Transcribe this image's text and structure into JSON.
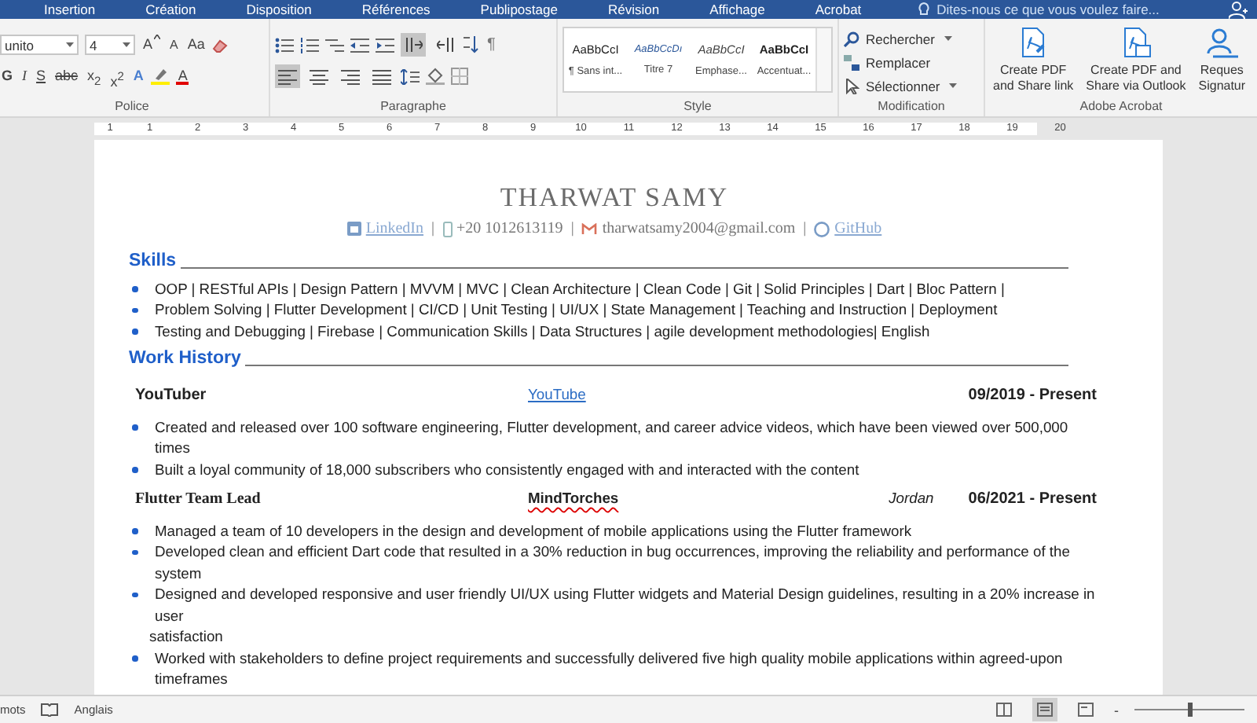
{
  "tabs": [
    {
      "label": "Insertion",
      "selected": false
    },
    {
      "label": "Création",
      "selected": false
    },
    {
      "label": "Disposition",
      "selected": false
    },
    {
      "label": "Références",
      "selected": false
    },
    {
      "label": "Publipostage",
      "selected": false
    },
    {
      "label": "Révision",
      "selected": false
    },
    {
      "label": "Affichage",
      "selected": false
    },
    {
      "label": "Acrobat",
      "selected": false
    }
  ],
  "tell_me": {
    "placeholder": "Dites-nous ce que vous voulez faire..."
  },
  "ribbon": {
    "font": {
      "name": "unito",
      "size": "4",
      "grow": "A",
      "shrink": "A",
      "case": "Aa",
      "bold": "G",
      "italic": "I",
      "underline": "S",
      "strike": "abc",
      "subscript": "x$_{2}$",
      "superscript": "x$^{2}$",
      "effects": "A",
      "color_letter": "A"
    },
    "paragraph": {
      "align": [
        {
          "selected": true
        },
        {
          "selected": false
        },
        {
          "selected": false
        },
        {
          "selected": false
        }
      ],
      "direction": [
        {
          "selected": true
        },
        {
          "selected": false
        }
      ],
      "pilcrow": "¶"
    },
    "styles": [
      {
        "sample": "AaBbCcI",
        "name": "¶ Sans int...",
        "kind": "normal"
      },
      {
        "sample": "AaBbCcDı",
        "name": "Titre 7",
        "kind": "heading"
      },
      {
        "sample": "AaBbCcI",
        "name": "Emphase...",
        "kind": "emphasis"
      },
      {
        "sample": "AaBbCcI",
        "name": "Accentuat...",
        "kind": "strong"
      }
    ],
    "editing": [
      {
        "label": "Rechercher",
        "kind": "find",
        "dropdown": true
      },
      {
        "label": "Remplacer",
        "kind": "replace",
        "dropdown": false
      },
      {
        "label": "Sélectionner",
        "kind": "select",
        "dropdown": true
      }
    ],
    "acrobat": [
      {
        "line1": "Create PDF",
        "line2": "and Share link",
        "kind": "link"
      },
      {
        "line1": "Create PDF and",
        "line2": "Share via Outlook",
        "kind": "mail"
      },
      {
        "line1": "Reques",
        "line2": "Signatur",
        "kind": "sign"
      }
    ],
    "groups": [
      "Police",
      "Paragraphe",
      "Style",
      "Modification",
      "Adobe Acrobat"
    ]
  },
  "ruler": {
    "marks": [
      "1",
      "1",
      "2",
      "3",
      "4",
      "5",
      "6",
      "7",
      "8",
      "9",
      "10",
      "11",
      "12",
      "13",
      "14",
      "15",
      "16",
      "17",
      "18",
      "19",
      "20"
    ]
  },
  "document": {
    "name": "THARWAT SAMY",
    "separator": "|",
    "contacts": [
      {
        "kind": "linkedin",
        "text": "LinkedIn"
      },
      {
        "kind": "phone",
        "text": "+20 1012613119"
      },
      {
        "kind": "email",
        "text": "tharwatsamy2004@gmail.com"
      },
      {
        "kind": "github",
        "text": "GitHub"
      }
    ],
    "skills": {
      "heading": "Skills",
      "items": [
        "OOP | RESTful APIs | Design Pattern | MVVM | MVC | Clean Architecture | Clean Code | Git | Solid Principles | Dart | Bloc Pattern |",
        "Problem Solving | Flutter Development | CI/CD | Unit Testing | UI/UX | State Management | Teaching and Instruction | Deployment",
        "Testing and Debugging | Firebase | Communication Skills | Data Structures | agile development methodologies| English"
      ]
    },
    "work": {
      "heading": "Work History",
      "jobs": [
        {
          "title": "YouTuber",
          "title_serif": false,
          "company": "YouTube",
          "company_is_link": true,
          "spelling_error": false,
          "dates": "09/2019 - Present",
          "bullets": [
            {
              "text": "Created and released over 100 software engineering, Flutter development, and career advice videos, which have been viewed over 500,000 times"
            },
            {
              "text": "Built a loyal community of 18,000 subscribers who consistently engaged with and interacted with the content"
            }
          ]
        },
        {
          "title": "Flutter Team Lead",
          "title_serif": true,
          "company": "MindTorches",
          "company_is_link": false,
          "spelling_error": true,
          "location": "Jordan",
          "dates": "06/2021 - Present",
          "bullets": [
            {
              "text": "Managed a team of 10 developers in the design and development of mobile applications using the Flutter framework"
            },
            {
              "text": "Developed clean and efficient Dart code that resulted in a 30% reduction in bug occurrences, improving the reliability and performance of the system"
            },
            {
              "text": "Designed and developed responsive and user friendly UI/UX using Flutter widgets and Material Design guidelines, resulting in a 20% increase in user",
              "continuation": "satisfaction"
            },
            {
              "text": "Worked with stakeholders to define project requirements and successfully delivered five high quality mobile applications within agreed-upon timeframes"
            }
          ]
        }
      ]
    }
  },
  "status_bar": {
    "words": "mots",
    "language": "Anglais",
    "views": [
      {
        "selected": false
      },
      {
        "selected": true
      },
      {
        "selected": false
      }
    ],
    "zoom_out": "-",
    "zoom": {
      "level": 0.5
    }
  }
}
